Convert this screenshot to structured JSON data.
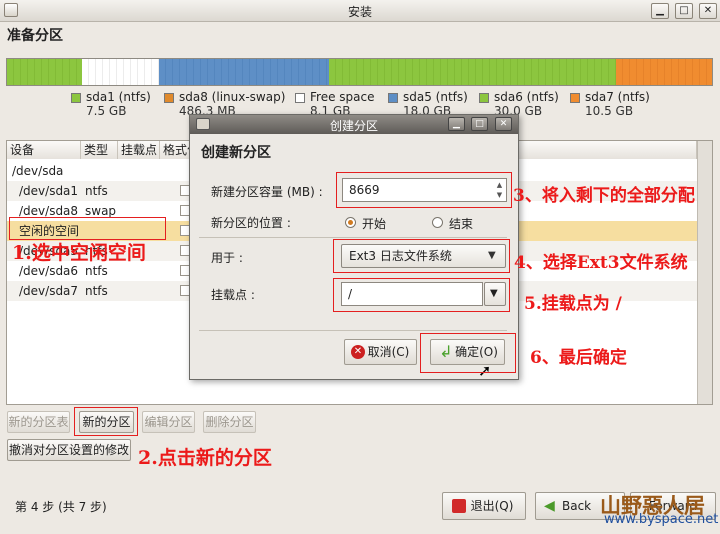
{
  "window": {
    "title": "安装",
    "minimize": "▁",
    "maximize": "□",
    "close": "✕"
  },
  "step_title": "准备分区",
  "partition_bar": [
    {
      "color": "#8cc63f",
      "width": 75
    },
    {
      "color": "#ffffff",
      "width": 77
    },
    {
      "color": "#5e8fc6",
      "width": 170
    },
    {
      "color": "#8cc63f",
      "width": 287
    },
    {
      "color": "#f08c30",
      "width": 98
    }
  ],
  "legend": [
    {
      "name": "sda1 (ntfs)",
      "size": "7.5 GB",
      "color": "#8cc63f"
    },
    {
      "name": "sda8 (linux-swap)",
      "size": "486.3 MB",
      "color": "#e08a2c"
    },
    {
      "name": "Free space",
      "size": "8.1 GB",
      "color": "#ffffff"
    },
    {
      "name": "sda5 (ntfs)",
      "size": "18.0 GB",
      "color": "#5e8fc6"
    },
    {
      "name": "sda6 (ntfs)",
      "size": "30.0 GB",
      "color": "#8cc63f"
    },
    {
      "name": "sda7 (ntfs)",
      "size": "10.5 GB",
      "color": "#f08c30"
    }
  ],
  "table": {
    "headers": [
      "设备",
      "类型",
      "挂载点",
      "格式化?"
    ],
    "rows": [
      {
        "device": "/dev/sda",
        "type": ""
      },
      {
        "device": "/dev/sda1",
        "type": "ntfs"
      },
      {
        "device": "/dev/sda8",
        "type": "swap"
      },
      {
        "device": "空闲的空间",
        "type": ""
      },
      {
        "device": "/dev/sda5",
        "type": "ntfs"
      },
      {
        "device": "/dev/sda6",
        "type": "ntfs"
      },
      {
        "device": "/dev/sda7",
        "type": "ntfs"
      }
    ]
  },
  "buttons": {
    "new_table": "新的分区表",
    "new_partition": "新的分区",
    "edit_partition": "编辑分区",
    "delete_partition": "删除分区",
    "revert": "撤消对分区设置的修改"
  },
  "step_text": "第 4 步 (共 7 步)",
  "nav": {
    "quit": "退出(Q)",
    "back": "Back",
    "forward": "Forward"
  },
  "dialog": {
    "title": "创建分区",
    "heading": "创建新分区",
    "size_label": "新建分区容量 (MB) :",
    "size_value": "8669",
    "location_label": "新分区的位置 :",
    "loc_begin": "开始",
    "loc_end": "结束",
    "use_label": "用于 :",
    "use_value": "Ext3 日志文件系统",
    "mount_label": "挂载点 :",
    "mount_value": "/",
    "cancel": "取消(C)",
    "ok": "确定(O)"
  },
  "annotations": {
    "a1": "1.选中空闲空间",
    "a2": "2.点击新的分区",
    "a3": "3、将入剩下的全部分配",
    "a4": "4、选择Ext3文件系统",
    "a5": "5.挂载点为 /",
    "a6": "6、最后确定"
  },
  "watermark": {
    "name": "山野惡人居",
    "url": "www.byspace.net"
  }
}
